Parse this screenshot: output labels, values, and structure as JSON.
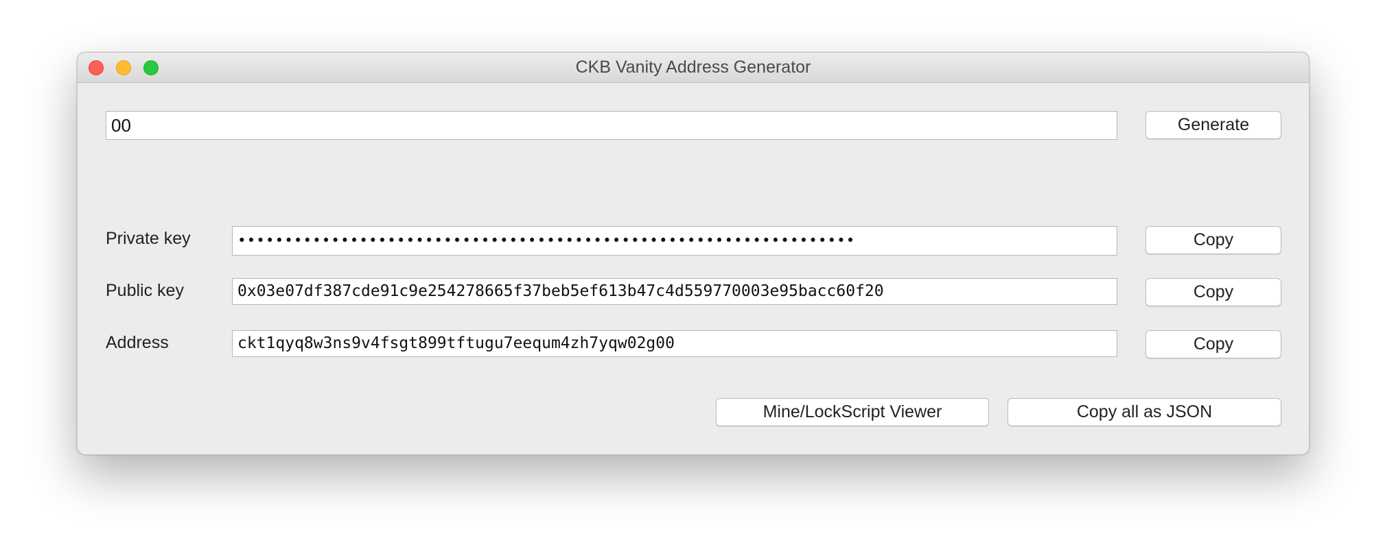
{
  "window": {
    "title": "CKB Vanity Address Generator"
  },
  "search": {
    "value": "00",
    "generate_label": "Generate"
  },
  "keys": {
    "private_key_label": "Private key",
    "private_key_value": "••••••••••••••••••••••••••••••••••••••••••••••••••••••••••••••••••",
    "public_key_label": "Public key",
    "public_key_value": "0x03e07df387cde91c9e254278665f37beb5ef613b47c4d559770003e95bacc60f20",
    "address_label": "Address",
    "address_value": "ckt1qyq8w3ns9v4fsgt899tftugu7eequm4zh7yqw02g00",
    "copy_label": "Copy"
  },
  "footer": {
    "viewer_label": "Mine/LockScript Viewer",
    "copy_json_label": "Copy all as JSON"
  }
}
